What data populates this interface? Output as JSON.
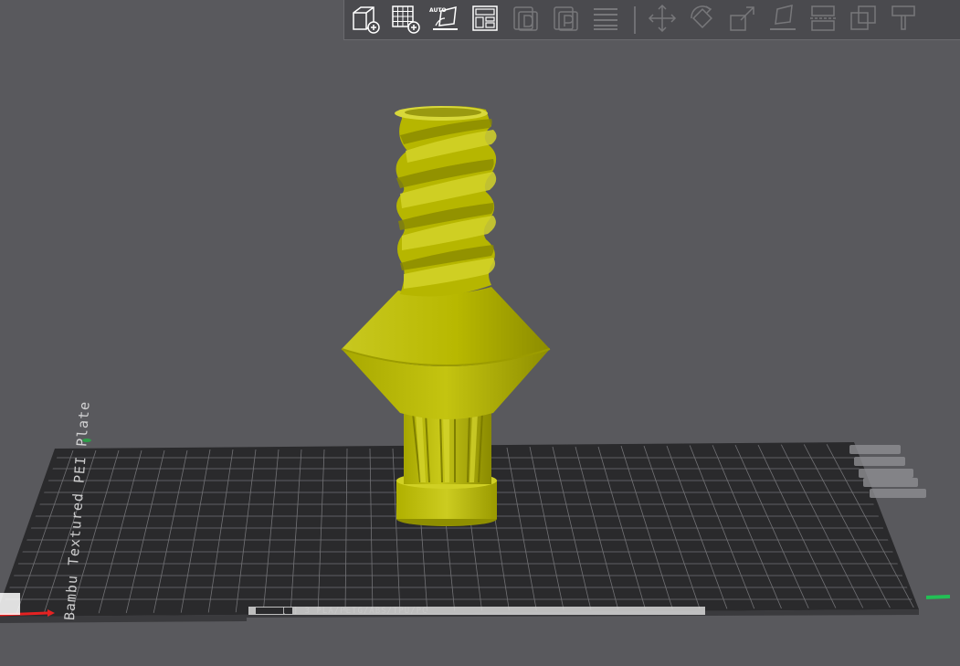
{
  "toolbar": {
    "auto_orient_label": "AUTO",
    "buttons": [
      {
        "name": "add-object-button",
        "icon": "cube-plus-icon",
        "enabled": true
      },
      {
        "name": "add-plate-button",
        "icon": "grid-plus-icon",
        "enabled": true
      },
      {
        "name": "auto-orient-button",
        "icon": "auto-orient-icon",
        "enabled": true
      },
      {
        "name": "arrange-button",
        "icon": "arrange-layout-icon",
        "enabled": true
      },
      {
        "name": "split-objects-button",
        "icon": "split-objects-icon",
        "enabled": false
      },
      {
        "name": "split-parts-button",
        "icon": "split-parts-icon",
        "enabled": false
      },
      {
        "name": "layers-button",
        "icon": "layers-icon",
        "enabled": false
      },
      {
        "name": "move-button",
        "icon": "move-icon",
        "enabled": false
      },
      {
        "name": "rotate-button",
        "icon": "rotate-icon",
        "enabled": false
      },
      {
        "name": "scale-button",
        "icon": "scale-icon",
        "enabled": false
      },
      {
        "name": "lay-on-face-button",
        "icon": "lay-on-face-icon",
        "enabled": false
      },
      {
        "name": "cut-button",
        "icon": "cut-icon",
        "enabled": false
      },
      {
        "name": "boolean-button",
        "icon": "boolean-icon",
        "enabled": false
      },
      {
        "name": "paint-button",
        "icon": "paint-icon",
        "enabled": false
      }
    ]
  },
  "bed": {
    "vertical_text": "Bambu Textured PEI Plate",
    "strip_text": "[ ] 3 PLA/PETG/ABS/TPU/PC"
  },
  "colors": {
    "background": "#59595d",
    "model": "#b8b800",
    "bed": "#2a2a2c",
    "grid": "#7a7a7e",
    "x_axis": "#e52222",
    "y_axis": "#22c055"
  },
  "axis": {
    "x_label": "",
    "y_label": "",
    "z_label": ""
  }
}
